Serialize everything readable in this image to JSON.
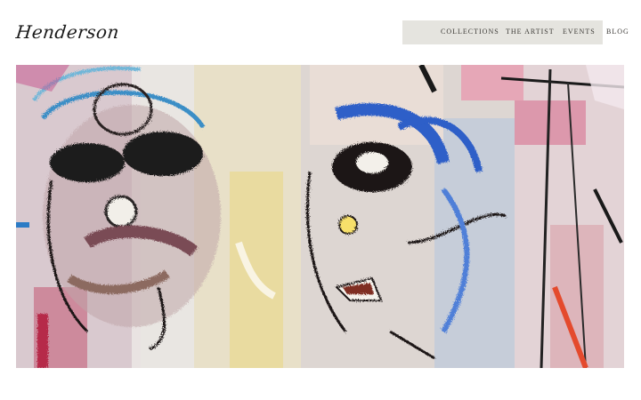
{
  "brand": {
    "logo_text": "Henderson"
  },
  "nav": {
    "items": [
      {
        "label": "COLLECTIONS"
      },
      {
        "label": "THE ARTIST"
      },
      {
        "label": "EVENTS"
      },
      {
        "label": "BLOG"
      }
    ]
  },
  "hero": {
    "image": "abstract-painting-two-faces"
  },
  "colors": {
    "nav_background": "#e5e4df",
    "text": "#3c3a36"
  }
}
